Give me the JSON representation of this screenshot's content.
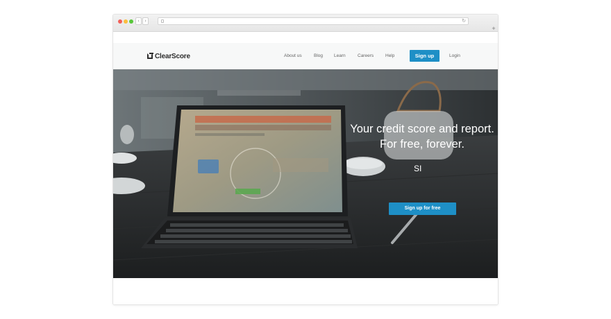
{
  "browser": {
    "url": "",
    "nav": {
      "back": "‹",
      "forward": "›"
    },
    "reload_glyph": "↻",
    "new_tab_glyph": "+"
  },
  "site": {
    "logo_text": "ClearScore",
    "nav": {
      "items": [
        "About us",
        "Blog",
        "Learn",
        "Careers",
        "Help"
      ],
      "signup_label": "Sign up",
      "login_label": "Login"
    }
  },
  "hero": {
    "heading": "Your credit score and report. For free, forever.",
    "sub": "SI",
    "cta_label": "Sign up for free"
  },
  "colors": {
    "accent": "#1e8fc6",
    "hero_bg": "#4a4f51",
    "text_dark": "#2d2d2d"
  }
}
